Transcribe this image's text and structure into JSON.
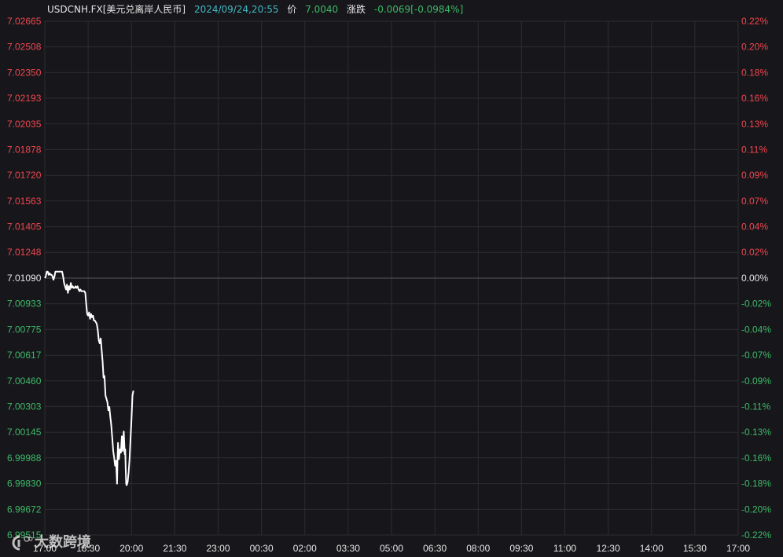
{
  "header": {
    "symbol": "USDCNH.FX[美元兑离岸人民币]",
    "timestamp": "2024/09/24,20:55",
    "price_label": "价",
    "price_value": "7.0040",
    "change_label": "涨跌",
    "change_value": "-0.0069[-0.0984%]"
  },
  "watermark": {
    "text": "大数跨境"
  },
  "colors": {
    "background": "#17171b",
    "grid": "#2c2c31",
    "line": "#ffffff",
    "baseline": "#555555",
    "up": "#f0454f",
    "down": "#3db868",
    "neutral": "#e6e6e6"
  },
  "chart_data": {
    "type": "line",
    "ylim": [
      6.99515,
      7.02665
    ],
    "base_price": 7.0109,
    "y_ticks": [
      {
        "value": 7.02665,
        "label": "7.02665",
        "pct": "0.22%"
      },
      {
        "value": 7.02508,
        "label": "7.02508",
        "pct": "0.20%"
      },
      {
        "value": 7.0235,
        "label": "7.02350",
        "pct": "0.18%"
      },
      {
        "value": 7.02193,
        "label": "7.02193",
        "pct": "0.16%"
      },
      {
        "value": 7.02035,
        "label": "7.02035",
        "pct": "0.13%"
      },
      {
        "value": 7.01878,
        "label": "7.01878",
        "pct": "0.11%"
      },
      {
        "value": 7.0172,
        "label": "7.01720",
        "pct": "0.09%"
      },
      {
        "value": 7.01563,
        "label": "7.01563",
        "pct": "0.07%"
      },
      {
        "value": 7.01405,
        "label": "7.01405",
        "pct": "0.04%"
      },
      {
        "value": 7.01248,
        "label": "7.01248",
        "pct": "0.02%"
      },
      {
        "value": 7.0109,
        "label": "7.01090",
        "pct": "0.00%"
      },
      {
        "value": 7.00933,
        "label": "7.00933",
        "pct": "-0.02%"
      },
      {
        "value": 7.00775,
        "label": "7.00775",
        "pct": "-0.04%"
      },
      {
        "value": 7.00617,
        "label": "7.00617",
        "pct": "-0.07%"
      },
      {
        "value": 7.0046,
        "label": "7.00460",
        "pct": "-0.09%"
      },
      {
        "value": 7.00303,
        "label": "7.00303",
        "pct": "-0.11%"
      },
      {
        "value": 7.00145,
        "label": "7.00145",
        "pct": "-0.13%"
      },
      {
        "value": 6.99988,
        "label": "6.99988",
        "pct": "-0.16%"
      },
      {
        "value": 6.9983,
        "label": "6.99830",
        "pct": "-0.18%"
      },
      {
        "value": 6.99672,
        "label": "6.99672",
        "pct": "-0.20%"
      },
      {
        "value": 6.99515,
        "label": "6.99515",
        "pct": "-0.22%"
      }
    ],
    "x_ticks": [
      "17:00",
      "18:30",
      "20:00",
      "21:30",
      "23:00",
      "00:30",
      "02:00",
      "03:30",
      "05:00",
      "06:30",
      "08:00",
      "09:30",
      "11:00",
      "12:30",
      "14:00",
      "15:30",
      "17:00"
    ],
    "series": [
      {
        "points": [
          [
            "17:00",
            7.0109
          ],
          [
            "17:02",
            7.011
          ],
          [
            "17:04",
            7.0113
          ],
          [
            "17:06",
            7.0113
          ],
          [
            "17:08",
            7.0111
          ],
          [
            "17:10",
            7.0112
          ],
          [
            "17:12",
            7.0111
          ],
          [
            "17:14",
            7.0111
          ],
          [
            "17:16",
            7.011
          ],
          [
            "17:18",
            7.0108
          ],
          [
            "17:20",
            7.011
          ],
          [
            "17:22",
            7.0113
          ],
          [
            "17:24",
            7.0113
          ],
          [
            "17:26",
            7.0113
          ],
          [
            "17:28",
            7.0113
          ],
          [
            "17:30",
            7.0113
          ],
          [
            "17:32",
            7.0113
          ],
          [
            "17:34",
            7.0113
          ],
          [
            "17:36",
            7.0113
          ],
          [
            "17:38",
            7.011
          ],
          [
            "17:40",
            7.0106
          ],
          [
            "17:42",
            7.0104
          ],
          [
            "17:44",
            7.0102
          ],
          [
            "17:46",
            7.0105
          ],
          [
            "17:48",
            7.01
          ],
          [
            "17:50",
            7.0104
          ],
          [
            "17:52",
            7.0102
          ],
          [
            "17:54",
            7.0106
          ],
          [
            "17:56",
            7.0103
          ],
          [
            "17:58",
            7.0104
          ],
          [
            "18:00",
            7.0103
          ],
          [
            "18:02",
            7.0103
          ],
          [
            "18:04",
            7.0104
          ],
          [
            "18:06",
            7.0103
          ],
          [
            "18:08",
            7.0104
          ],
          [
            "18:10",
            7.0102
          ],
          [
            "18:12",
            7.0101
          ],
          [
            "18:14",
            7.0102
          ],
          [
            "18:16",
            7.0101
          ],
          [
            "18:18",
            7.0101
          ],
          [
            "18:20",
            7.0101
          ],
          [
            "18:22",
            7.0101
          ],
          [
            "18:24",
            7.01
          ],
          [
            "18:26",
            7.0093
          ],
          [
            "18:28",
            7.0087
          ],
          [
            "18:30",
            7.0086
          ],
          [
            "18:32",
            7.0088
          ],
          [
            "18:34",
            7.0084
          ],
          [
            "18:36",
            7.0087
          ],
          [
            "18:38",
            7.0085
          ],
          [
            "18:40",
            7.0086
          ],
          [
            "18:42",
            7.0083
          ],
          [
            "18:44",
            7.0083
          ],
          [
            "18:46",
            7.0082
          ],
          [
            "18:48",
            7.0081
          ],
          [
            "18:50",
            7.0077
          ],
          [
            "18:52",
            7.0071
          ],
          [
            "18:54",
            7.0069
          ],
          [
            "18:56",
            7.0072
          ],
          [
            "18:58",
            7.0065
          ],
          [
            "19:00",
            7.0058
          ],
          [
            "19:02",
            7.0048
          ],
          [
            "19:04",
            7.0049
          ],
          [
            "19:06",
            7.0037
          ],
          [
            "19:08",
            7.0035
          ],
          [
            "19:10",
            7.0033
          ],
          [
            "19:12",
            7.0028
          ],
          [
            "19:14",
            7.003
          ],
          [
            "19:16",
            7.0024
          ],
          [
            "19:18",
            7.0019
          ],
          [
            "19:20",
            7.0011
          ],
          [
            "19:22",
            7.0003
          ],
          [
            "19:24",
            6.9999
          ],
          [
            "19:26",
            6.9994
          ],
          [
            "19:28",
            6.9997
          ],
          [
            "19:30",
            6.9983
          ],
          [
            "19:31",
            6.9998
          ],
          [
            "19:32",
            7.0008
          ],
          [
            "19:34",
            6.9998
          ],
          [
            "19:36",
            7.0004
          ],
          [
            "19:38",
            7.0002
          ],
          [
            "19:40",
            7.0012
          ],
          [
            "19:42",
            7.0003
          ],
          [
            "19:44",
            7.0015
          ],
          [
            "19:46",
            7.0001
          ],
          [
            "19:47",
            7.0004
          ],
          [
            "19:48",
            6.9992
          ],
          [
            "19:49",
            6.9983
          ],
          [
            "19:50",
            6.9982
          ],
          [
            "19:52",
            6.9984
          ],
          [
            "19:54",
            6.999
          ],
          [
            "19:56",
            6.9998
          ],
          [
            "19:58",
            7.001
          ],
          [
            "20:00",
            7.0023
          ],
          [
            "20:02",
            7.0037
          ],
          [
            "20:04",
            7.004
          ]
        ]
      }
    ]
  }
}
